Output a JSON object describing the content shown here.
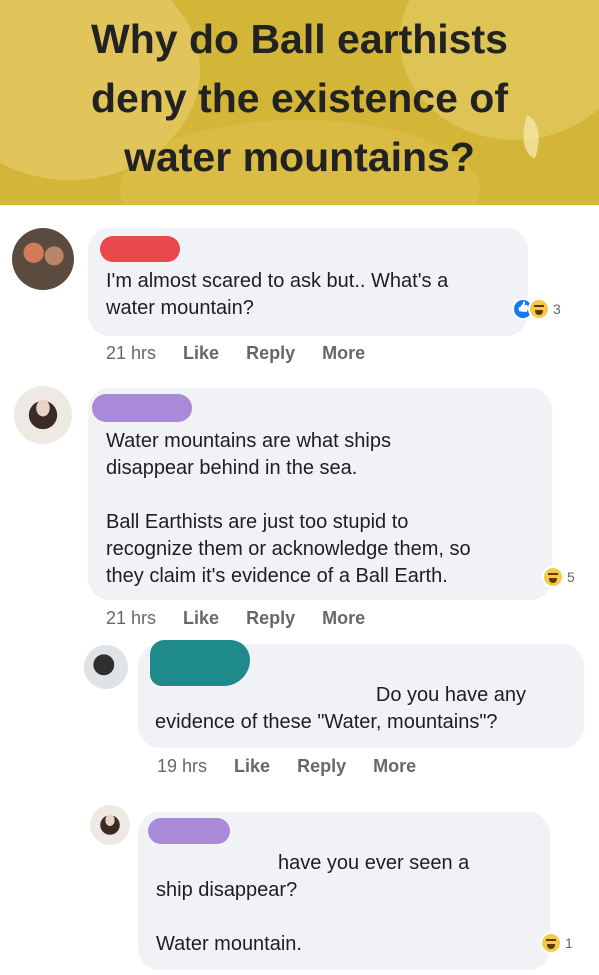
{
  "banner": {
    "title_lines": [
      "Why do Ball earthists",
      "deny the existence of",
      "water mountains?"
    ],
    "color": "#d3b637"
  },
  "comments": [
    {
      "text_lines": [
        "I'm almost scared to ask but.. What's a",
        "water mountain?"
      ],
      "reactions": {
        "icons": [
          "like-icon",
          "haha-icon"
        ],
        "count": "3"
      },
      "meta": {
        "time": "21 hrs",
        "like": "Like",
        "reply": "Reply",
        "more": "More"
      },
      "name_redaction_color": "#e8474c"
    },
    {
      "paragraph1": [
        "Water mountains are what ships",
        "disappear behind in the sea."
      ],
      "paragraph2": [
        "Ball Earthists are just too stupid to",
        "recognize them or acknowledge them, so",
        "they claim it's evidence of a Ball Earth."
      ],
      "reactions": {
        "icons": [
          "haha-icon"
        ],
        "count": "5"
      },
      "meta": {
        "time": "21 hrs",
        "like": "Like",
        "reply": "Reply",
        "more": "More"
      },
      "name_redaction_color": "#a88ad8"
    },
    {
      "text_lines": [
        "Do you have any",
        "evidence of these \"Water, mountains\"?"
      ],
      "meta": {
        "time": "19 hrs",
        "like": "Like",
        "reply": "Reply",
        "more": "More"
      },
      "name_redaction_color": "#1f8a8a"
    },
    {
      "text_lines": [
        "have you ever seen a",
        "ship disappear?"
      ],
      "text_line3": "Water mountain.",
      "reactions": {
        "icons": [
          "haha-icon"
        ],
        "count": "1"
      },
      "name_redaction_color": "#a88ad8"
    }
  ]
}
